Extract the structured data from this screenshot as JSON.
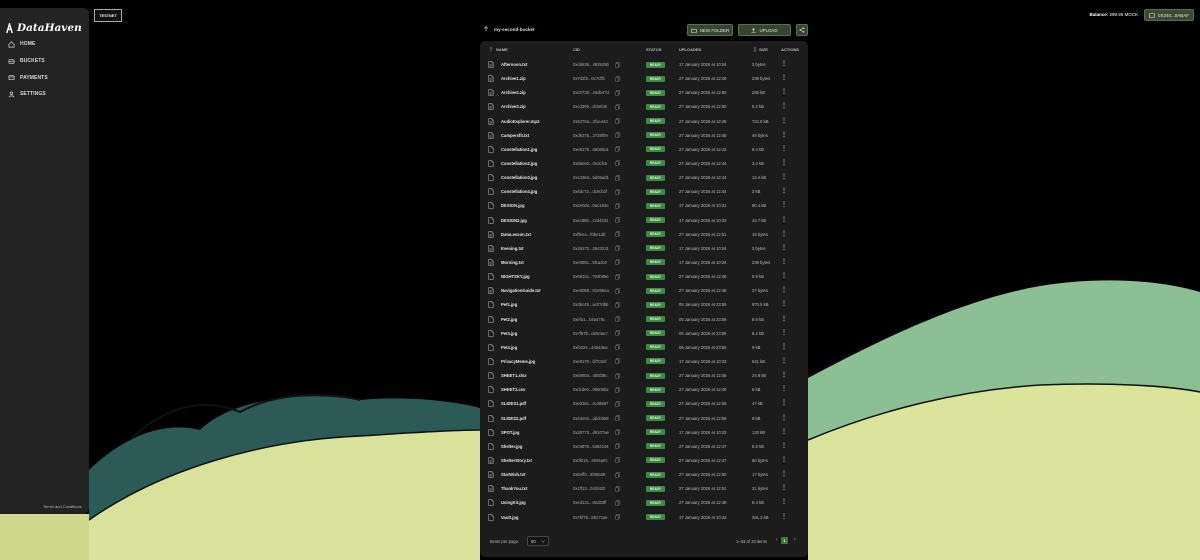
{
  "app": {
    "name": "DataHaven"
  },
  "sidebar": {
    "items": [
      {
        "label": "HOME",
        "icon": "home-icon"
      },
      {
        "label": "BUCKETS",
        "icon": "bucket-icon"
      },
      {
        "label": "PAYMENTS",
        "icon": "wallet-icon"
      },
      {
        "label": "SETTINGS",
        "icon": "user-icon"
      }
    ],
    "footer": "Terms and Conditions"
  },
  "network_badge": "TESTNET",
  "header": {
    "balance_label": "Balance:",
    "balance_value": "299.95 MOCK",
    "wallet_address": "0X240...0ABAF"
  },
  "toolbar": {
    "bucket_name": "my-second-bucket",
    "new_folder_label": "NEW FOLDER",
    "upload_label": "UPLOAD"
  },
  "table": {
    "columns": {
      "name": "NAME",
      "cid": "CID",
      "status": "STATUS",
      "uploaded": "UPLOADED",
      "size": "SIZE",
      "actions": "ACTIONS"
    },
    "rows": [
      {
        "name": "Afternoon.txt",
        "cid": "0xdd636...482525b",
        "status": "READY",
        "uploaded": "17 January 2026 at 10:34",
        "size": "3 bytes",
        "type": "doc"
      },
      {
        "name": "Archive1.zip",
        "cid": "0x7d3f3...0c7cffb",
        "status": "READY",
        "uploaded": "27 January 2026 at 12:49",
        "size": "236 bytes",
        "type": "doc"
      },
      {
        "name": "Archive2.zip",
        "cid": "0x22730...26db47d",
        "status": "READY",
        "uploaded": "27 January 2026 at 12:50",
        "size": "290 kB",
        "type": "doc"
      },
      {
        "name": "Archive3.zip",
        "cid": "0xcd309...dc0ef40",
        "status": "READY",
        "uploaded": "27 January 2026 at 12:50",
        "size": "5.2 kB",
        "type": "doc"
      },
      {
        "name": "AudioExplorer.mp3",
        "cid": "0x5376a...3f1e443",
        "status": "READY",
        "uploaded": "27 January 2026 at 12:45",
        "size": "722.8 kB",
        "type": "doc"
      },
      {
        "name": "Campersfit.txt",
        "cid": "0xd537b...3729f09",
        "status": "READY",
        "uploaded": "27 January 2026 at 12:48",
        "size": "49 bytes",
        "type": "doc"
      },
      {
        "name": "Constellation1.jpg",
        "cid": "0xe817b...65b66a1",
        "status": "READY",
        "uploaded": "27 January 2026 at 12:43",
        "size": "8.4 kB",
        "type": "file"
      },
      {
        "name": "Constellation2.jpg",
        "cid": "0x5be62...0e3cfc5",
        "status": "READY",
        "uploaded": "27 January 2026 at 12:44",
        "size": "3.2 kB",
        "type": "file"
      },
      {
        "name": "Constellation3.jpg",
        "cid": "0x13364...5d05ad1",
        "status": "READY",
        "uploaded": "27 January 2026 at 12:44",
        "size": "13.4 kB",
        "type": "file"
      },
      {
        "name": "Constellation4.jpg",
        "cid": "0x6dc72...d18cb2f",
        "status": "READY",
        "uploaded": "27 January 2026 at 12:44",
        "size": "3 kB",
        "type": "file"
      },
      {
        "name": "DESIGN.jpg",
        "cid": "0x2e0d4...0ac183e",
        "status": "READY",
        "uploaded": "17 January 2026 at 10:31",
        "size": "90.4 kB",
        "type": "file"
      },
      {
        "name": "DESIGN2.jpg",
        "cid": "0xec88b...c2d4332",
        "status": "READY",
        "uploaded": "17 January 2026 at 10:33",
        "size": "44.7 kB",
        "type": "file"
      },
      {
        "name": "DataLesson.txt",
        "cid": "0xffeea...f0be1dd",
        "status": "READY",
        "uploaded": "27 January 2026 at 12:51",
        "size": "18 bytes",
        "type": "doc"
      },
      {
        "name": "Evening.txt",
        "cid": "0x26272...2643231",
        "status": "READY",
        "uploaded": "17 January 2026 at 10:34",
        "size": "3 bytes",
        "type": "doc"
      },
      {
        "name": "Morning.txt",
        "cid": "0xe085c...5fcadc0",
        "status": "READY",
        "uploaded": "17 January 2026 at 10:34",
        "size": "236 bytes",
        "type": "doc"
      },
      {
        "name": "NIGHTSKY.jpg",
        "cid": "0x0810c...703b85e",
        "status": "READY",
        "uploaded": "27 January 2026 at 12:46",
        "size": "5.9 kB",
        "type": "file"
      },
      {
        "name": "NavigationGuide.txt",
        "cid": "0xe6068...81e59ea",
        "status": "READY",
        "uploaded": "27 January 2026 at 12:48",
        "size": "27 bytes",
        "type": "doc"
      },
      {
        "name": "Pet1.jpg",
        "cid": "0x3bc48...ac07dbb",
        "status": "READY",
        "uploaded": "05 January 2026 at 23:55",
        "size": "870.5 kB",
        "type": "file"
      },
      {
        "name": "Pet2.jpg",
        "cid": "0xefa1...04a479c",
        "status": "READY",
        "uploaded": "05 January 2026 at 23:56",
        "size": "8.8 kB",
        "type": "file"
      },
      {
        "name": "Pet3.jpg",
        "cid": "0x7f67b...de50ae7",
        "status": "READY",
        "uploaded": "05 January 2026 at 23:56",
        "size": "8.2 kB",
        "type": "file"
      },
      {
        "name": "Pet4.jpg",
        "cid": "0xfc034...4454dea",
        "status": "READY",
        "uploaded": "05 January 2026 at 23:56",
        "size": "9 kB",
        "type": "file"
      },
      {
        "name": "PrivacyMeme.jpg",
        "cid": "0xe8170...bf7031f",
        "status": "READY",
        "uploaded": "17 January 2026 at 10:33",
        "size": "621 kB",
        "type": "file"
      },
      {
        "name": "SHEET1.xlsx",
        "cid": "0x60804...405f36c",
        "status": "READY",
        "uploaded": "27 January 2026 at 12:45",
        "size": "24.8 kB",
        "type": "file"
      },
      {
        "name": "SHEET2.csv",
        "cid": "0xdcde0...08005b2",
        "status": "READY",
        "uploaded": "27 January 2026 at 12:45",
        "size": "6 kB",
        "type": "file"
      },
      {
        "name": "SLIDES1.pdf",
        "cid": "0x0338c...4c38887",
        "status": "READY",
        "uploaded": "27 January 2026 at 12:58",
        "size": "47 kB",
        "type": "file"
      },
      {
        "name": "SLIDES2.pdf",
        "cid": "0x44e0e...ddcbb58",
        "status": "READY",
        "uploaded": "27 January 2026 at 12:58",
        "size": "9 kB",
        "type": "file"
      },
      {
        "name": "SPOT.jpg",
        "cid": "0x28773...d8107ae",
        "status": "READY",
        "uploaded": "17 January 2026 at 10:33",
        "size": "133 kB",
        "type": "file"
      },
      {
        "name": "Shelter.jpg",
        "cid": "0xc5878...5482104",
        "status": "READY",
        "uploaded": "27 January 2026 at 12:47",
        "size": "8.8 kB",
        "type": "file"
      },
      {
        "name": "ShelterStory.txt",
        "cid": "0x0f015...3045a01",
        "status": "READY",
        "uploaded": "27 January 2026 at 12:47",
        "size": "60 bytes",
        "type": "doc"
      },
      {
        "name": "StarWish.txt",
        "cid": "0x5eff0...8f48a59",
        "status": "READY",
        "uploaded": "27 January 2026 at 12:50",
        "size": "17 bytes",
        "type": "doc"
      },
      {
        "name": "ThankYou.txt",
        "cid": "0x1ff13...041b5f2",
        "status": "READY",
        "uploaded": "27 January 2026 at 12:51",
        "size": "21 bytes",
        "type": "doc"
      },
      {
        "name": "UsingKit.jpg",
        "cid": "0xed131...82d33ff",
        "status": "READY",
        "uploaded": "27 January 2026 at 12:48",
        "size": "8.4 kB",
        "type": "file"
      },
      {
        "name": "Vault.jpg",
        "cid": "0x7bf76...8027cae",
        "status": "READY",
        "uploaded": "17 January 2026 at 10:33",
        "size": "391.3 kB",
        "type": "file"
      }
    ]
  },
  "pagination": {
    "per_page_label": "Items per page:",
    "per_page_value": "50",
    "range": "1–33 of 33 items",
    "current_page": "1"
  },
  "colors": {
    "ready": "#3d8a45",
    "accent": "#354530",
    "panel": "#1c1c1c",
    "sidebar": "#232323"
  }
}
